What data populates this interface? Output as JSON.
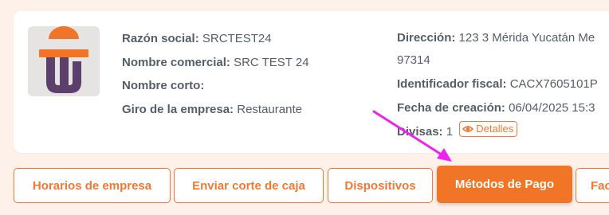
{
  "company": {
    "logo_icon": "company-logo",
    "fields_left": [
      {
        "label": "Razón social:",
        "value": "SRCTEST24"
      },
      {
        "label": "Nombre comercial:",
        "value": "SRC TEST 24"
      },
      {
        "label": "Nombre corto:",
        "value": ""
      },
      {
        "label": "Giro de la empresa:",
        "value": "Restaurante"
      }
    ],
    "direccion": {
      "label": "Dirección:",
      "value_line1": "123 3 Mérida Yucatán Me",
      "value_line2": "97314"
    },
    "identificador": {
      "label": "Identificador fiscal:",
      "value": "CACX7605101P"
    },
    "fecha": {
      "label": "Fecha de creación:",
      "value": "06/04/2025 15:3"
    },
    "divisas": {
      "label": "Divisas:",
      "value": "1",
      "details_label": "Detalles",
      "details_icon": "eye-icon"
    }
  },
  "tabs": [
    {
      "label": "Horarios de empresa",
      "active": false
    },
    {
      "label": "Enviar corte de caja",
      "active": false
    },
    {
      "label": "Dispositivos",
      "active": false
    },
    {
      "label": "Métodos de Pago",
      "active": true
    },
    {
      "label": "Fac",
      "active": false
    }
  ],
  "colors": {
    "accent": "#ee7a35",
    "active_tab": "#f07526",
    "background": "#fdf1ea",
    "annotation_arrow": "#ee22ee"
  }
}
